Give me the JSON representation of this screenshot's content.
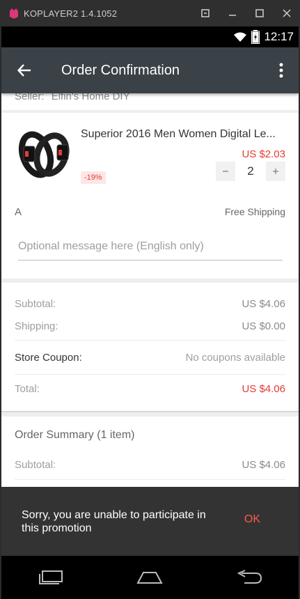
{
  "emulator": {
    "title": "KOPLAYER2 1.4.1052"
  },
  "status_bar": {
    "time": "12:17"
  },
  "app_bar": {
    "title": "Order Confirmation"
  },
  "seller": {
    "label": "Seller:",
    "name": "Elfin's Home DIY"
  },
  "product": {
    "title": "Superior 2016 Men Women Digital Le...",
    "price": "US $2.03",
    "discount": "-19%",
    "quantity": "2",
    "shipping_option": "A",
    "shipping_label": "Free Shipping",
    "message_placeholder": "Optional message here (English only)"
  },
  "totals": {
    "subtotal_label": "Subtotal:",
    "subtotal_value": "US $4.06",
    "shipping_label": "Shipping:",
    "shipping_value": "US $0.00",
    "coupon_label": "Store Coupon:",
    "coupon_value": "No coupons available",
    "total_label": "Total:",
    "total_value": "US $4.06"
  },
  "summary": {
    "title": "Order Summary (1 item)",
    "subtotal_label": "Subtotal:",
    "subtotal_value": "US $4.06"
  },
  "snackbar": {
    "message": "Sorry, you are unable to participate in this promotion",
    "action": "OK"
  },
  "colors": {
    "accent_red": "#e53935",
    "appbar": "#3a4147",
    "snackbar": "#333333"
  }
}
